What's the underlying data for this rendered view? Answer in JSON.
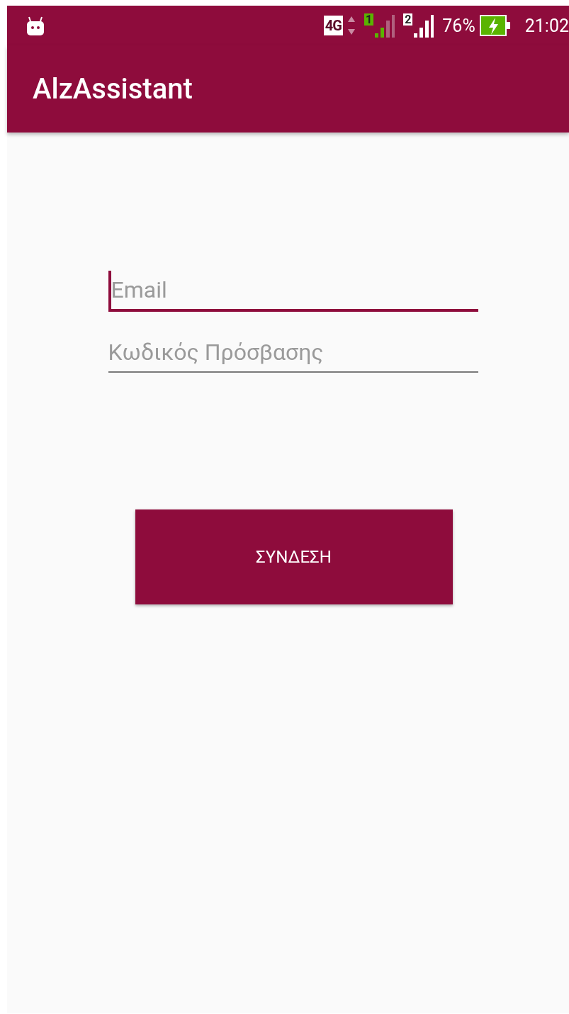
{
  "status_bar": {
    "network": "4G",
    "sims": [
      {
        "label": "1",
        "active": true
      },
      {
        "label": "2",
        "active": false
      }
    ],
    "battery": "76%",
    "charging": true,
    "time": "21:02"
  },
  "app_bar": {
    "title": "AlzAssistant"
  },
  "fields": [
    {
      "placeholder": "Email",
      "focused": true
    },
    {
      "placeholder": "Κωδικός Πρόσβασης",
      "focused": false
    }
  ],
  "button": {
    "label": "ΣΥΝΔΕΣΗ"
  }
}
